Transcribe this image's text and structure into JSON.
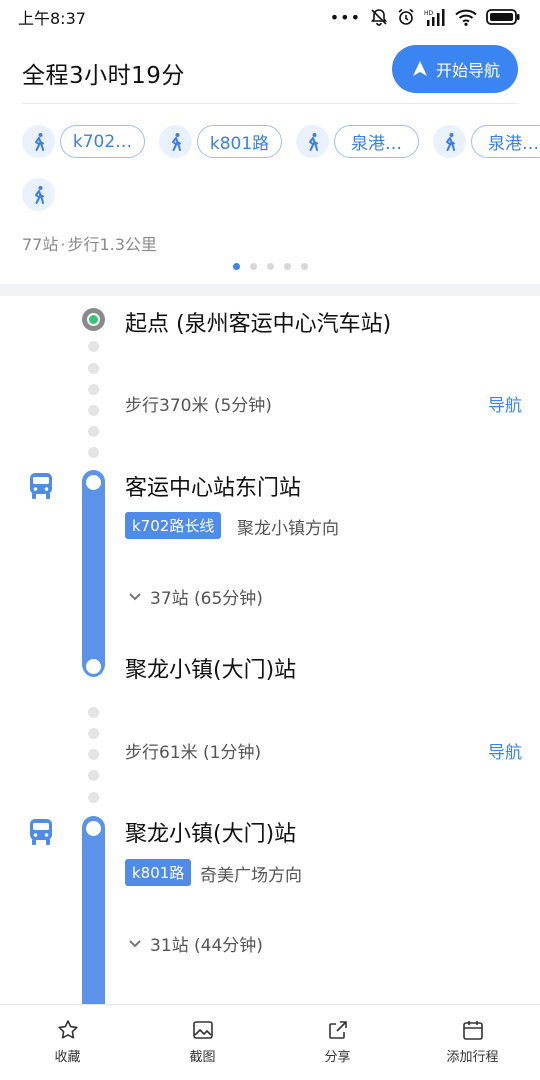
{
  "status_bar": {
    "time": "上午8:37"
  },
  "header": {
    "summary": "全程3小时19分",
    "start_nav_label": "开始导航"
  },
  "route_chips": {
    "lines": [
      "k702…",
      "k801路",
      "泉港…",
      "泉港…"
    ]
  },
  "route_stats": {
    "stops": "77站",
    "separator": "·",
    "walk": "步行1.3公里"
  },
  "page_indicator": {
    "total": 5,
    "active": 1
  },
  "timeline": {
    "origin": {
      "name": "起点 (泉州客运中心汽车站)"
    },
    "walk1": {
      "text": "步行370米 (5分钟)",
      "nav_label": "导航"
    },
    "leg1": {
      "board_stop": "客运中心站东门站",
      "line": "k702路长线",
      "direction": "聚龙小镇方向",
      "stops_info": "37站 (65分钟)",
      "alight_stop": "聚龙小镇(大门)站"
    },
    "walk2": {
      "text": "步行61米 (1分钟)",
      "nav_label": "导航"
    },
    "leg2": {
      "board_stop": "聚龙小镇(大门)站",
      "line": "k801路",
      "direction": "奇美广场方向",
      "stops_info": "31站 (44分钟)"
    }
  },
  "bottom_bar": {
    "favorite": "收藏",
    "screenshot": "截图",
    "share": "分享",
    "add_trip": "添加行程"
  },
  "colors": {
    "accent": "#3a85f2",
    "bus_line": "#5b92ea",
    "chip_border": "#9dc0f2",
    "origin_green": "#36c47a"
  },
  "icons": [
    "bell-off-icon",
    "alarm-icon",
    "signal-icon",
    "wifi-icon",
    "battery-icon",
    "navigation-arrow-icon",
    "walk-icon",
    "bus-icon",
    "chevron-down-icon",
    "star-icon",
    "image-icon",
    "share-icon",
    "calendar-icon"
  ]
}
